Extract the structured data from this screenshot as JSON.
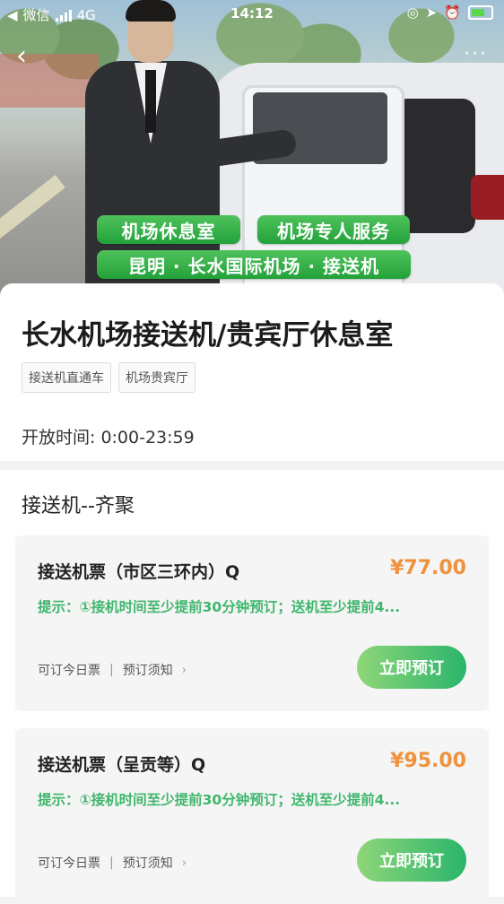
{
  "status_bar": {
    "carrier": "微信",
    "network": "4G",
    "time": "14:12"
  },
  "hero": {
    "banners": [
      "机场休息室",
      "机场专人服务",
      "昆明 · 长水国际机场 · 接送机"
    ]
  },
  "info": {
    "title": "长水机场接送机/贵宾厅休息室",
    "tags": [
      "接送机直通车",
      "机场贵宾厅"
    ],
    "hours": "开放时间:  0:00-23:59"
  },
  "section": {
    "title": "接送机--齐聚",
    "products": [
      {
        "name": "接送机票（市区三环内）Q",
        "price": "¥77.00",
        "tip": "提示：①接机时间至少提前30分钟预订；送机至少提前4...",
        "meta_today": "可订今日票",
        "meta_notice": "预订须知",
        "book_label": "立即预订"
      },
      {
        "name": "接送机票（呈贡等）Q",
        "price": "¥95.00",
        "tip": "提示：①接机时间至少提前30分钟预订；送机至少提前4...",
        "meta_today": "可订今日票",
        "meta_notice": "预订须知",
        "book_label": "立即预订"
      }
    ]
  },
  "colors": {
    "price": "#f0923b",
    "tip_green": "#3fb66c",
    "button_start": "#8fd679",
    "button_end": "#2ab56b"
  }
}
